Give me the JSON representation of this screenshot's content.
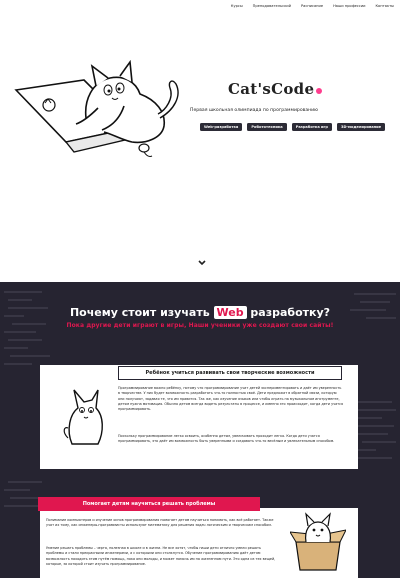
{
  "nav": {
    "items": [
      "Курсы",
      "Преподавательский",
      "Расписание",
      "Наши профессии",
      "Контакты"
    ]
  },
  "hero": {
    "logo_text": "Cat'sCode",
    "tagline": "Первая школьная олимпиада по программированию",
    "chips": [
      "Web-разработка",
      "Робототехника",
      "Разработка игр",
      "3D-моделирование"
    ]
  },
  "why": {
    "title_pre": "Почему стоит изучать ",
    "title_highlight": "Web",
    "title_post": " разработку?",
    "subtitle": "Пока другие дети играют в игры, Наши ученики уже создают свои сайты!",
    "panel_heading": "Ребёнок учиться развивать свои творческие возможности",
    "para1": "Программирование важно ребёнку, потому что программирование учит детей экспериментировать и даёт им уверенность в творчестве. У них будет возможность разработать что-то полностью своё. Дети предложат в обратной связи, которую они получают, задавая те, что им нравится. Так же, как изучение языков или чтобы играть на музыкальном инструменте, детям нужна мотивация. Обычно детям всегда видеть результаты в процессе, и именно это происходит, когда дети учатся программировать.",
    "para2": "Поскольку программирование легко освоить, особенно детям, увеличивать проходит легко. Когда дети учатся программировать, это даёт им возможность быть уверенными и создавать что-то весёлым и увлекательным способом."
  },
  "problems": {
    "heading": "Помогает детям научиться решать проблемы",
    "para1": "Понимание компьютеров и изучение основ программирования помогает детям научиться понимать, как всё работает. Также учат их тому, как инженеры-программисты используют математику для решения задач логическим и творческим способом.",
    "para2": "Умение решать проблемы – черта, полезная в школе и в жизни. Не все хотят, чтобы наши дети отлично умели решать проблемы и стали прекрасными инженерами, а с которыми они столкнутся. Обучение программированию даёт детям возможность находить этим путём помощь, пока они молоды, и может помочь им на жизненном пути. Это одна из тех вещей, которые, за которой стоит изучать программирование."
  },
  "colors": {
    "accent": "#e0174f",
    "dark_bg": "#262431",
    "chip_bg": "#2c2b36",
    "logo_dot": "#ff3d8e"
  }
}
